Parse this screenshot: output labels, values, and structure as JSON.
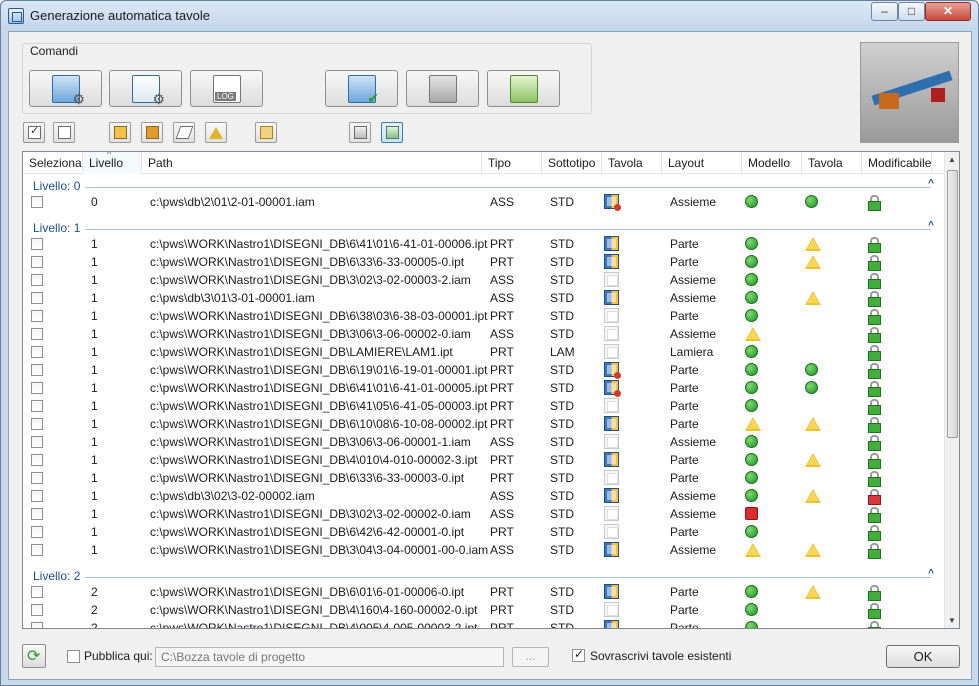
{
  "window": {
    "title": "Generazione automatica tavole",
    "controls": {
      "minimize": "–",
      "maximize": "□",
      "close": "✕"
    }
  },
  "commands": {
    "group_label": "Comandi",
    "big_buttons": [
      {
        "name": "layout-settings-button",
        "icon": "window-gear-icon"
      },
      {
        "name": "list-settings-button",
        "icon": "list-gear-icon"
      },
      {
        "name": "log-button",
        "icon": "log-file-icon",
        "icon_text": "LOG"
      },
      {
        "name": "generate-drawings-button",
        "icon": "drawings-check-icon"
      },
      {
        "name": "disabled-tool-button",
        "icon": "gray-drawings-icon"
      },
      {
        "name": "notebook-button",
        "icon": "green-notebook-icon"
      }
    ],
    "small_buttons": [
      {
        "name": "select-all-button",
        "icon": "checkbox-icon"
      },
      {
        "name": "deselect-all-button",
        "icon": "empty-box-icon"
      },
      {
        "name": "part-filter-button",
        "icon": "box-icon"
      },
      {
        "name": "assembly-filter-button",
        "icon": "assembly-icon"
      },
      {
        "name": "eraser-button",
        "icon": "eraser-icon"
      },
      {
        "name": "warning-filter-button",
        "icon": "warning-icon"
      },
      {
        "name": "export-button",
        "icon": "folder-arrow-icon"
      },
      {
        "name": "view-mode-1-button",
        "icon": "traffic-light-icon"
      },
      {
        "name": "view-mode-2-button",
        "icon": "traffic-light-icon"
      }
    ]
  },
  "table": {
    "columns": [
      "Seleziona",
      "Livello",
      "Path",
      "Tipo",
      "Sottotipo",
      "Tavola",
      "Layout",
      "Modello",
      "Tavola",
      "Modificabile"
    ],
    "groups": [
      {
        "label": "Livello: 0",
        "rows": [
          {
            "level": "0",
            "path": "c:\\pws\\db\\2\\01\\2-01-00001.iam",
            "tipo": "ASS",
            "sottotipo": "STD",
            "tavola": "drawing-red",
            "layout": "Assieme",
            "modello": "green",
            "tavola_status": "green",
            "modificabile": "open"
          }
        ]
      },
      {
        "label": "Livello: 1",
        "rows": [
          {
            "level": "1",
            "path": "c:\\pws\\WORK\\Nastro1\\DISEGNI_DB\\6\\41\\01\\6-41-01-00006.ipt",
            "tipo": "PRT",
            "sottotipo": "STD",
            "tavola": "drawing",
            "layout": "Parte",
            "modello": "green",
            "tavola_status": "warning",
            "modificabile": "open"
          },
          {
            "level": "1",
            "path": "c:\\pws\\WORK\\Nastro1\\DISEGNI_DB\\6\\33\\6-33-00005-0.ipt",
            "tipo": "PRT",
            "sottotipo": "STD",
            "tavola": "drawing",
            "layout": "Parte",
            "modello": "green",
            "tavola_status": "warning",
            "modificabile": "open"
          },
          {
            "level": "1",
            "path": "c:\\pws\\WORK\\Nastro1\\DISEGNI_DB\\3\\02\\3-02-00003-2.iam",
            "tipo": "ASS",
            "sottotipo": "STD",
            "tavola": "empty",
            "layout": "Assieme",
            "modello": "green",
            "tavola_status": "",
            "modificabile": "open"
          },
          {
            "level": "1",
            "path": "c:\\pws\\db\\3\\01\\3-01-00001.iam",
            "tipo": "ASS",
            "sottotipo": "STD",
            "tavola": "drawing",
            "layout": "Assieme",
            "modello": "green",
            "tavola_status": "warning",
            "modificabile": "open"
          },
          {
            "level": "1",
            "path": "c:\\pws\\WORK\\Nastro1\\DISEGNI_DB\\6\\38\\03\\6-38-03-00001.ipt",
            "tipo": "PRT",
            "sottotipo": "STD",
            "tavola": "empty",
            "layout": "Parte",
            "modello": "green",
            "tavola_status": "",
            "modificabile": "open"
          },
          {
            "level": "1",
            "path": "c:\\pws\\WORK\\Nastro1\\DISEGNI_DB\\3\\06\\3-06-00002-0.iam",
            "tipo": "ASS",
            "sottotipo": "STD",
            "tavola": "empty",
            "layout": "Assieme",
            "modello": "warning",
            "tavola_status": "",
            "modificabile": "open"
          },
          {
            "level": "1",
            "path": "c:\\pws\\WORK\\Nastro1\\DISEGNI_DB\\LAMIERE\\LAM1.ipt",
            "tipo": "PRT",
            "sottotipo": "LAM",
            "tavola": "empty",
            "layout": "Lamiera",
            "modello": "green",
            "tavola_status": "",
            "modificabile": "open"
          },
          {
            "level": "1",
            "path": "c:\\pws\\WORK\\Nastro1\\DISEGNI_DB\\6\\19\\01\\6-19-01-00001.ipt",
            "tipo": "PRT",
            "sottotipo": "STD",
            "tavola": "drawing-red",
            "layout": "Parte",
            "modello": "green",
            "tavola_status": "green",
            "modificabile": "open"
          },
          {
            "level": "1",
            "path": "c:\\pws\\WORK\\Nastro1\\DISEGNI_DB\\6\\41\\01\\6-41-01-00005.ipt",
            "tipo": "PRT",
            "sottotipo": "STD",
            "tavola": "drawing-red",
            "layout": "Parte",
            "modello": "green",
            "tavola_status": "green",
            "modificabile": "open"
          },
          {
            "level": "1",
            "path": "c:\\pws\\WORK\\Nastro1\\DISEGNI_DB\\6\\41\\05\\6-41-05-00003.ipt",
            "tipo": "PRT",
            "sottotipo": "STD",
            "tavola": "empty",
            "layout": "Parte",
            "modello": "green",
            "tavola_status": "",
            "modificabile": "open"
          },
          {
            "level": "1",
            "path": "c:\\pws\\WORK\\Nastro1\\DISEGNI_DB\\6\\10\\08\\6-10-08-00002.ipt",
            "tipo": "PRT",
            "sottotipo": "STD",
            "tavola": "drawing",
            "layout": "Parte",
            "modello": "warning",
            "tavola_status": "warning",
            "modificabile": "open"
          },
          {
            "level": "1",
            "path": "c:\\pws\\WORK\\Nastro1\\DISEGNI_DB\\3\\06\\3-06-00001-1.iam",
            "tipo": "ASS",
            "sottotipo": "STD",
            "tavola": "empty",
            "layout": "Assieme",
            "modello": "green",
            "tavola_status": "",
            "modificabile": "open"
          },
          {
            "level": "1",
            "path": "c:\\pws\\WORK\\Nastro1\\DISEGNI_DB\\4\\010\\4-010-00002-3.ipt",
            "tipo": "PRT",
            "sottotipo": "STD",
            "tavola": "drawing",
            "layout": "Parte",
            "modello": "green",
            "tavola_status": "warning",
            "modificabile": "open"
          },
          {
            "level": "1",
            "path": "c:\\pws\\WORK\\Nastro1\\DISEGNI_DB\\6\\33\\6-33-00003-0.ipt",
            "tipo": "PRT",
            "sottotipo": "STD",
            "tavola": "empty",
            "layout": "Parte",
            "modello": "green",
            "tavola_status": "",
            "modificabile": "open"
          },
          {
            "level": "1",
            "path": "c:\\pws\\db\\3\\02\\3-02-00002.iam",
            "tipo": "ASS",
            "sottotipo": "STD",
            "tavola": "drawing",
            "layout": "Assieme",
            "modello": "green",
            "tavola_status": "warning",
            "modificabile": "closed"
          },
          {
            "level": "1",
            "path": "c:\\pws\\WORK\\Nastro1\\DISEGNI_DB\\3\\02\\3-02-00002-0.iam",
            "tipo": "ASS",
            "sottotipo": "STD",
            "tavola": "empty",
            "layout": "Assieme",
            "modello": "red",
            "tavola_status": "",
            "modificabile": "open"
          },
          {
            "level": "1",
            "path": "c:\\pws\\WORK\\Nastro1\\DISEGNI_DB\\6\\42\\6-42-00001-0.ipt",
            "tipo": "PRT",
            "sottotipo": "STD",
            "tavola": "empty",
            "layout": "Parte",
            "modello": "green",
            "tavola_status": "",
            "modificabile": "open"
          },
          {
            "level": "1",
            "path": "c:\\pws\\WORK\\Nastro1\\DISEGNI_DB\\3\\04\\3-04-00001-00-0.iam",
            "tipo": "ASS",
            "sottotipo": "STD",
            "tavola": "drawing",
            "layout": "Assieme",
            "modello": "warning",
            "tavola_status": "warning",
            "modificabile": "open"
          }
        ]
      },
      {
        "label": "Livello: 2",
        "rows": [
          {
            "level": "2",
            "path": "c:\\pws\\WORK\\Nastro1\\DISEGNI_DB\\6\\01\\6-01-00006-0.ipt",
            "tipo": "PRT",
            "sottotipo": "STD",
            "tavola": "drawing",
            "layout": "Parte",
            "modello": "green",
            "tavola_status": "warning",
            "modificabile": "open"
          },
          {
            "level": "2",
            "path": "c:\\pws\\WORK\\Nastro1\\DISEGNI_DB\\4\\160\\4-160-00002-0.ipt",
            "tipo": "PRT",
            "sottotipo": "STD",
            "tavola": "empty",
            "layout": "Parte",
            "modello": "green",
            "tavola_status": "",
            "modificabile": "open"
          },
          {
            "level": "2",
            "path": "c:\\pws\\WORK\\Nastro1\\DISEGNI_DB\\4\\005\\4-005-00003-2.ipt",
            "tipo": "PRT",
            "sottotipo": "STD",
            "tavola": "drawing",
            "layout": "Parte",
            "modello": "green",
            "tavola_status": "",
            "modificabile": "open"
          }
        ]
      }
    ]
  },
  "footer": {
    "publish_label": "Pubblica qui:",
    "publish_path": "C:\\Bozza tavole di progetto",
    "browse_label": "...",
    "overwrite_label": "Sovrascrivi tavole esistenti",
    "overwrite_checked": true,
    "ok_label": "OK"
  },
  "colors": {
    "accent": "#1e4f8f",
    "ok": "#2fa12f",
    "warning": "#f0c230",
    "error": "#d92c2c"
  }
}
